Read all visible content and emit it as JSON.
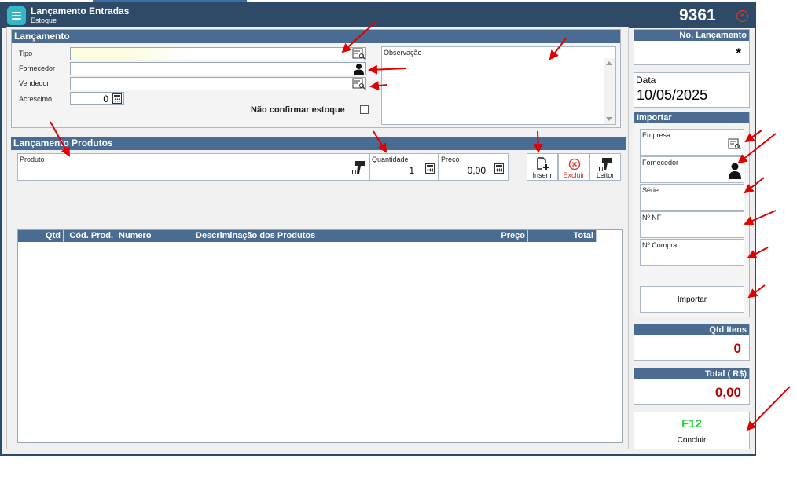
{
  "window": {
    "title": "Lançamento Entradas",
    "subtitle": "Estoque",
    "number": "9361"
  },
  "lancamento": {
    "header": "Lançamento",
    "tipo_label": "Tipo",
    "tipo_value": "",
    "fornecedor_label": "Fornecedor",
    "fornecedor_value": "",
    "vendedor_label": "Vendedor",
    "vendedor_value": "",
    "acrescimo_label": "Acrescimo",
    "acrescimo_value": "0",
    "nao_confirmar_label": "Não confirmar estoque",
    "nao_confirmar_checked": false,
    "observacao_label": "Observação",
    "observacao_value": ""
  },
  "produtos": {
    "header": "Lançamento Produtos",
    "produto_label": "Produto",
    "quantidade_label": "Quantidade",
    "quantidade_value": "1",
    "preco_label": "Preço",
    "preco_value": "0,00",
    "inserir_label": "Inserir",
    "excluir_label": "Excluir",
    "leitor_label": "Leitor"
  },
  "table": {
    "columns": [
      "Qtd",
      "Cód. Prod.",
      "Numero",
      "Descriminação dos Produtos",
      "Preço",
      "Total"
    ],
    "rows": []
  },
  "sidebar": {
    "no_lancamento_label": "No. Lançamento",
    "no_lancamento_value": "*",
    "data_label": "Data",
    "data_value": "10/05/2025",
    "importar_header": "Importar",
    "empresa_label": "Empresa",
    "fornecedor_label": "Fornecedor",
    "serie_label": "Série",
    "nf_label": "Nº NF",
    "compra_label": "Nº Compra",
    "importar_button": "Importar",
    "qtd_itens_label": "Qtd Itens",
    "qtd_itens_value": "0",
    "total_label": "Total ( R$)",
    "total_value": "0,00",
    "concluir_shortcut": "F12",
    "concluir_label": "Concluir"
  },
  "colors": {
    "title_bar": "#2e4a66",
    "section_header": "#4a6c92",
    "value_red": "#c00000",
    "shortcut_green": "#2ecc40",
    "annotation_arrow": "#e00000"
  },
  "icons": {
    "search_list": "search-list-icon",
    "person": "person-icon",
    "calculator": "calculator-icon",
    "barcode_scanner": "barcode-scanner-icon",
    "add_document": "add-document-icon",
    "delete_circle": "delete-circle-icon",
    "close": "close-icon"
  }
}
